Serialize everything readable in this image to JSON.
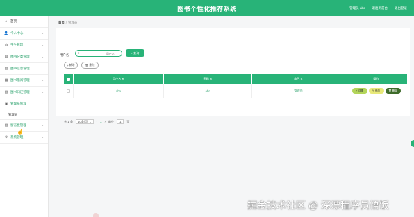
{
  "header": {
    "title": "图书个性化推荐系统",
    "role": "管理员 abo",
    "front_link": "退出到前台",
    "logout": "退出登录"
  },
  "sidebar": {
    "items": [
      {
        "label": "首页",
        "icon": "home-icon"
      },
      {
        "label": "个人中心",
        "icon": "user-icon"
      },
      {
        "label": "学生管理",
        "icon": "student-icon"
      },
      {
        "label": "图书分类管理",
        "icon": "category-icon"
      },
      {
        "label": "图书信息管理",
        "icon": "book-icon"
      },
      {
        "label": "图书借阅管理",
        "icon": "borrow-icon"
      },
      {
        "label": "图书归还管理",
        "icon": "return-icon"
      },
      {
        "label": "管理员管理",
        "icon": "admin-icon",
        "sub": "管理员"
      },
      {
        "label": "留言板管理",
        "icon": "message-icon"
      },
      {
        "label": "系统管理",
        "icon": "settings-icon"
      }
    ]
  },
  "breadcrumb": {
    "home": "首页",
    "current": "管理员"
  },
  "search": {
    "label": "用户名",
    "placeholder": "用户名",
    "button": "查询"
  },
  "toolbar": {
    "add": "新增",
    "delete": "删除"
  },
  "table": {
    "headers": [
      "用户名",
      "密码",
      "角色",
      "操作"
    ],
    "rows": [
      {
        "username": "abo",
        "password": "abo",
        "role": "管理员"
      }
    ],
    "actions": {
      "detail": "详情",
      "edit": "修改",
      "delete": "删除"
    }
  },
  "pager": {
    "total": "共 1 条",
    "page_size": "10条/页",
    "current_page": "1",
    "goto_label": "前往",
    "goto_value": "1",
    "goto_suffix": "页"
  },
  "watermark": "掘金技术社区 @ 深漂程序员悟饭",
  "colors": {
    "primary": "#28b378",
    "detail": "#b3d55a",
    "edit": "#e8e979",
    "delete": "#3e6b2a"
  }
}
